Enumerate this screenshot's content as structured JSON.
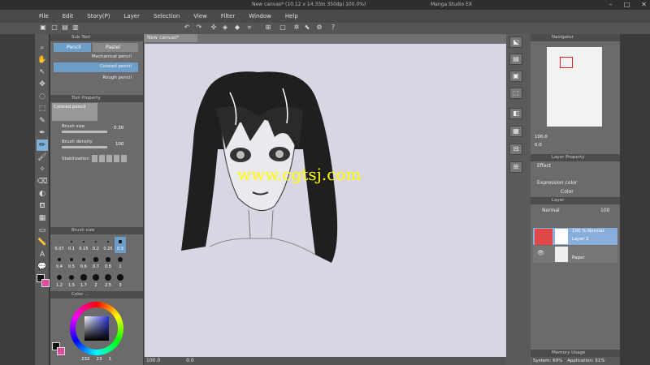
{
  "window": {
    "title": "New canvas* (10.12 x 14.33in 350dpi 100.0%)",
    "app_name": "Manga Studio EX"
  },
  "menu": [
    "File",
    "Edit",
    "Story(P)",
    "Layer",
    "Selection",
    "View",
    "Filter",
    "Window",
    "Help"
  ],
  "document_tab": "New canvas*",
  "sub_tool": {
    "header": "Sub Tool",
    "tabs": [
      "Pencil",
      "Pastel"
    ],
    "items": [
      "Mechanical pencil",
      "Colored pencil",
      "Rough pencil"
    ],
    "selected": "Colored pencil"
  },
  "tool_property": {
    "header": "Tool Property",
    "tool_name": "Colored pencil",
    "brush_size_label": "Brush size",
    "brush_size_value": "0.30",
    "brush_density_label": "Brush density",
    "brush_density_value": "100",
    "stabilization_label": "Stabilization"
  },
  "brush_size_panel": {
    "header": "Brush size",
    "sizes": [
      "0.07",
      "0.1",
      "0.15",
      "0.2",
      "0.25",
      "0.3",
      "0.4",
      "0.5",
      "0.6",
      "0.7",
      "0.8",
      "1",
      "1.2",
      "1.5",
      "1.7",
      "2",
      "2.5",
      "3"
    ]
  },
  "color_panel": {
    "header": "Color ...",
    "values": [
      "232",
      "23",
      "1"
    ]
  },
  "navigator": {
    "header": "Navigator",
    "zoom": "100.0",
    "rotation": "0.0"
  },
  "layer_property": {
    "header": "Layer Property",
    "effect_label": "Effect",
    "expression_color_label": "Expression color",
    "color_value": "Color"
  },
  "layer": {
    "header": "Layer",
    "blend_mode": "Normal",
    "opacity": "100",
    "layers": [
      {
        "name": "Layer 2",
        "info": "100 %  Normal",
        "selected": true
      },
      {
        "name": "Paper",
        "info": "",
        "selected": false
      }
    ]
  },
  "memory": {
    "header": "Memory Usage",
    "system": "System: 60%",
    "application": "Application: 51%"
  },
  "bottom": {
    "zoom": "100.0",
    "rotation": "0.0"
  },
  "watermark": "www.cgtsj.com"
}
